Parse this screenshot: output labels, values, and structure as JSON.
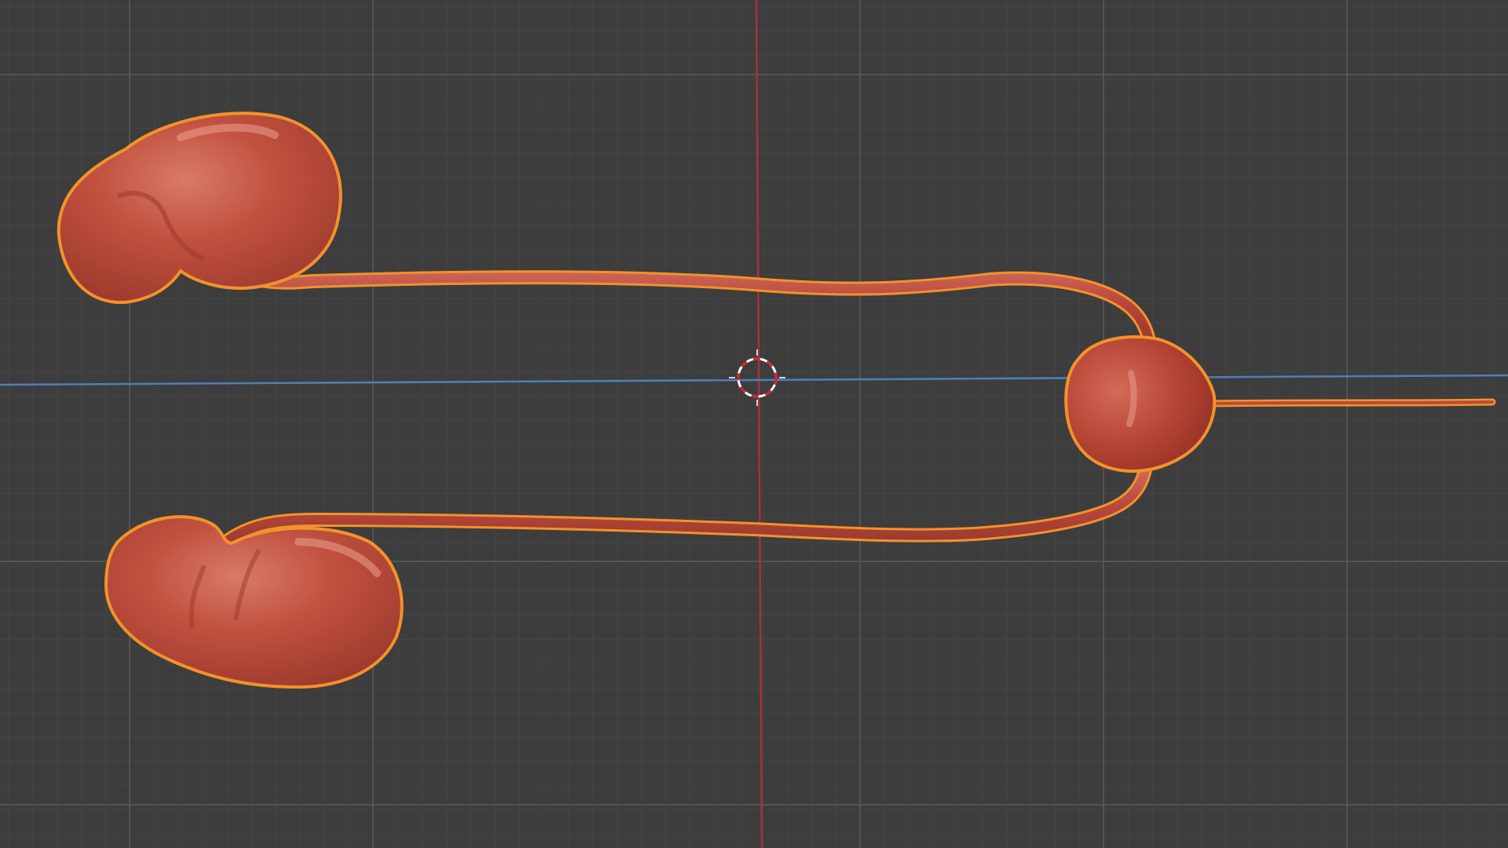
{
  "viewport": {
    "background_color": "#3d3d3d",
    "grid_minor_color": "#474747",
    "grid_major_color": "#525252",
    "x_axis_color": "#4f7fb8",
    "y_axis_color": "#a8303f",
    "selection_outline_color": "#f2922b",
    "organ_color": "#c0503f"
  },
  "scene": {
    "objects": [
      {
        "name": "kidney-left-upper",
        "selected": true
      },
      {
        "name": "kidney-left-lower",
        "selected": true
      },
      {
        "name": "ureter-upper",
        "selected": true
      },
      {
        "name": "ureter-lower",
        "selected": true
      },
      {
        "name": "bladder",
        "selected": true
      },
      {
        "name": "urethra",
        "selected": true
      }
    ],
    "cursor": {
      "icon": "3d-cursor-icon"
    }
  }
}
